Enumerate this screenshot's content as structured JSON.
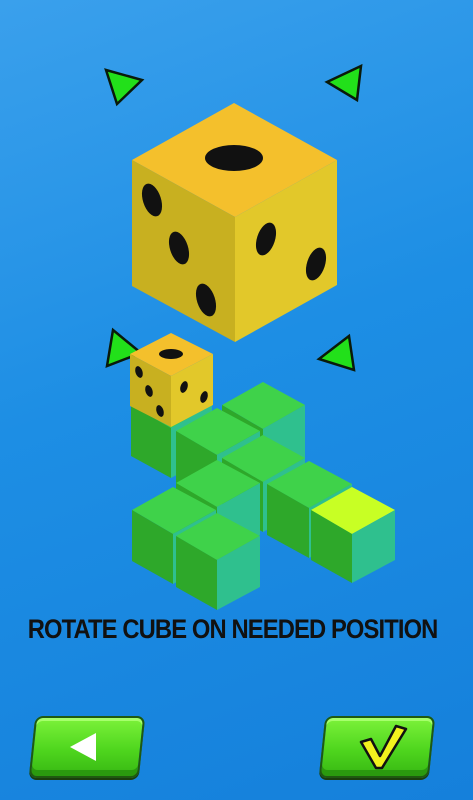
{
  "instruction": "ROTATE CUBE ON NEEDED POSITION",
  "colors": {
    "background": "#1d8ee4",
    "die_top": "#f4c02c",
    "die_left": "#c9b322",
    "die_right": "#e0c62a",
    "pip": "#111111",
    "tile_top": "#3fd24a",
    "tile_left": "#2ea82a",
    "tile_right": "#2fc08e",
    "goal_top": "#c8ff24",
    "arrow": "#22e01a",
    "button": "#55d820"
  },
  "icons": {
    "rotate_arrows": "triangle-arrow-icon",
    "back_button": "left-triangle-icon",
    "confirm_button": "checkmark-icon"
  }
}
